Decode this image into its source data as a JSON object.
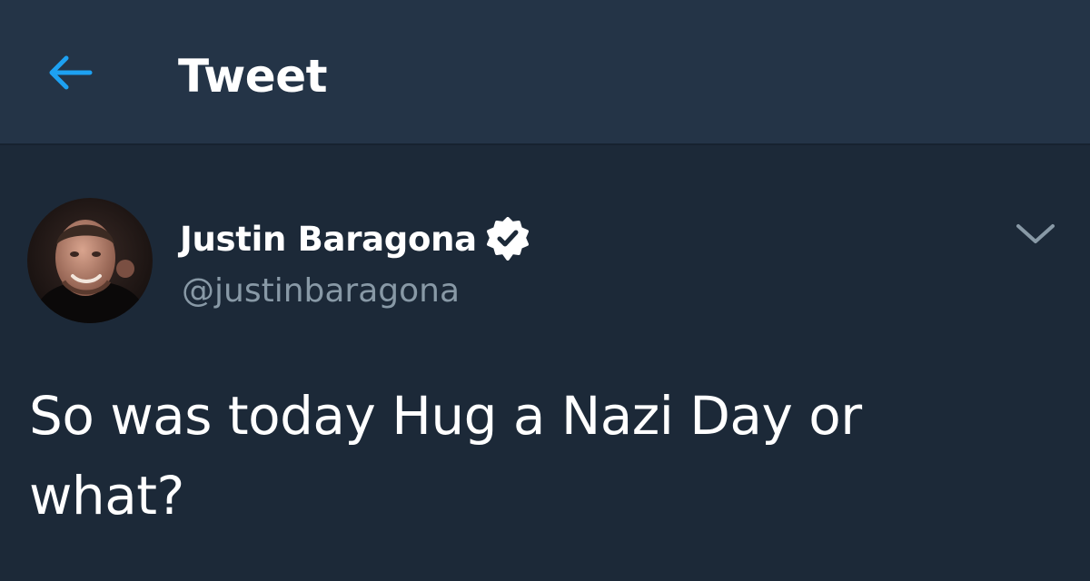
{
  "header": {
    "title": "Tweet",
    "back_icon": "arrow-left-icon",
    "accent_color": "#1da1f2"
  },
  "tweet": {
    "author": {
      "display_name": "Justin Baragona",
      "handle": "@justinbaragona",
      "verified": true,
      "verified_icon": "verified-badge-icon",
      "avatar_icon": "user-avatar"
    },
    "menu_icon": "chevron-down-icon",
    "text": "So was today Hug a Nazi Day or what?"
  },
  "colors": {
    "header_bg": "#243447",
    "body_bg": "#1c2938",
    "text_primary": "#ffffff",
    "text_secondary": "#8899a6"
  }
}
